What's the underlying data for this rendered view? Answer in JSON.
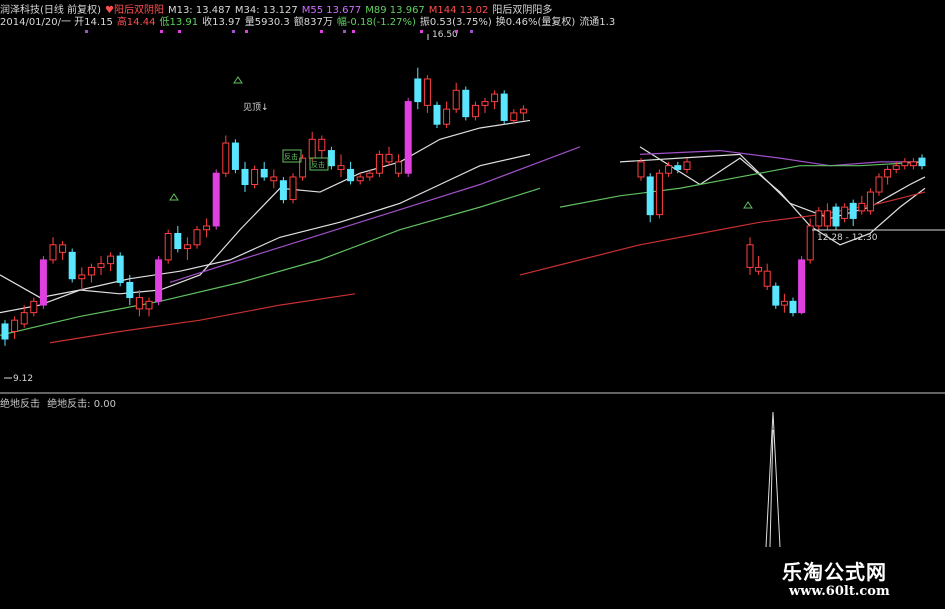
{
  "header": {
    "line1": [
      {
        "text": "润泽科技(日线 前复权)",
        "color": "#d8d8d8"
      },
      {
        "text": "♥阳后双阴阳",
        "color": "#ff5050"
      },
      {
        "text": "M13: 13.487",
        "color": "#d8d8d8"
      },
      {
        "text": "M34: 13.127",
        "color": "#d8d8d8"
      },
      {
        "text": "M55 13.677",
        "color": "#d070ff"
      },
      {
        "text": "M89 13.967",
        "color": "#60d060"
      },
      {
        "text": "M144 13.02",
        "color": "#ff5050"
      },
      {
        "text": "阳后双阴阳多",
        "color": "#d8d8d8"
      }
    ],
    "line2": [
      {
        "text": "2014/01/20/一 开14.15",
        "color": "#d8d8d8"
      },
      {
        "text": "高14.44",
        "color": "#ff5050"
      },
      {
        "text": "低13.91",
        "color": "#60d060"
      },
      {
        "text": "收13.97",
        "color": "#d8d8d8"
      },
      {
        "text": "量5930.3",
        "color": "#d8d8d8"
      },
      {
        "text": "额837万",
        "color": "#d8d8d8"
      },
      {
        "text": "幅-0.18(-1.27%)",
        "color": "#60d060"
      },
      {
        "text": "振0.53(3.75%)",
        "color": "#d8d8d8"
      },
      {
        "text": "换0.46%(量复权)",
        "color": "#d8d8d8"
      },
      {
        "text": "流通1.3",
        "color": "#d8d8d8"
      }
    ]
  },
  "indicator": {
    "name": "绝地反击",
    "label": "绝地反击: 0.00"
  },
  "annotations": {
    "high_label": "16.50",
    "low_label": "9.12",
    "jianding": "见顶↓",
    "range_label": "12.28 - 12.30",
    "fan": "反击"
  },
  "watermark": {
    "cn": "乐淘公式网",
    "url": "www.60lt.com"
  },
  "colors": {
    "up": "#ff4040",
    "down": "#5ae6ff",
    "magenta": "#e040e0",
    "ma_white": "#e0e0e0",
    "ma_purple": "#a050c8",
    "ma_green": "#60c060",
    "ma_red": "#c83030"
  },
  "chart_data": {
    "type": "candlestick",
    "y_axis_price_range": [
      9.12,
      16.5
    ],
    "candles_left": [
      {
        "o": 9.3,
        "h": 9.8,
        "l": 9.12,
        "c": 9.7,
        "k": "down"
      },
      {
        "o": 9.5,
        "h": 9.9,
        "l": 9.3,
        "c": 9.8,
        "k": "up"
      },
      {
        "o": 9.7,
        "h": 10.2,
        "l": 9.6,
        "c": 10.0,
        "k": "up"
      },
      {
        "o": 10.0,
        "h": 10.4,
        "l": 9.9,
        "c": 10.3,
        "k": "up"
      },
      {
        "o": 10.2,
        "h": 11.5,
        "l": 10.1,
        "c": 11.4,
        "k": "m"
      },
      {
        "o": 11.4,
        "h": 12.0,
        "l": 11.3,
        "c": 11.8,
        "k": "up"
      },
      {
        "o": 11.8,
        "h": 11.9,
        "l": 11.4,
        "c": 11.6,
        "k": "up"
      },
      {
        "o": 11.6,
        "h": 11.7,
        "l": 10.8,
        "c": 10.9,
        "k": "down"
      },
      {
        "o": 10.9,
        "h": 11.2,
        "l": 10.6,
        "c": 11.0,
        "k": "up"
      },
      {
        "o": 11.0,
        "h": 11.3,
        "l": 10.8,
        "c": 11.2,
        "k": "up"
      },
      {
        "o": 11.2,
        "h": 11.5,
        "l": 11.0,
        "c": 11.3,
        "k": "up"
      },
      {
        "o": 11.3,
        "h": 11.6,
        "l": 11.1,
        "c": 11.5,
        "k": "up"
      },
      {
        "o": 11.5,
        "h": 11.6,
        "l": 10.7,
        "c": 10.8,
        "k": "down"
      },
      {
        "o": 10.8,
        "h": 11.0,
        "l": 10.2,
        "c": 10.4,
        "k": "down"
      },
      {
        "o": 10.4,
        "h": 10.6,
        "l": 9.9,
        "c": 10.1,
        "k": "up"
      },
      {
        "o": 10.1,
        "h": 10.4,
        "l": 9.9,
        "c": 10.3,
        "k": "up"
      },
      {
        "o": 10.3,
        "h": 11.5,
        "l": 10.2,
        "c": 11.4,
        "k": "m"
      },
      {
        "o": 11.4,
        "h": 12.2,
        "l": 11.3,
        "c": 12.1,
        "k": "up"
      },
      {
        "o": 12.1,
        "h": 12.3,
        "l": 11.6,
        "c": 11.7,
        "k": "down"
      },
      {
        "o": 11.7,
        "h": 12.0,
        "l": 11.4,
        "c": 11.8,
        "k": "up"
      },
      {
        "o": 11.8,
        "h": 12.3,
        "l": 11.7,
        "c": 12.2,
        "k": "up"
      },
      {
        "o": 12.2,
        "h": 12.5,
        "l": 12.0,
        "c": 12.3,
        "k": "up"
      },
      {
        "o": 12.3,
        "h": 13.8,
        "l": 12.2,
        "c": 13.7,
        "k": "m"
      },
      {
        "o": 13.7,
        "h": 14.7,
        "l": 13.6,
        "c": 14.5,
        "k": "up"
      },
      {
        "o": 14.5,
        "h": 14.6,
        "l": 13.7,
        "c": 13.8,
        "k": "down"
      },
      {
        "o": 13.8,
        "h": 14.0,
        "l": 13.2,
        "c": 13.4,
        "k": "down"
      },
      {
        "o": 13.4,
        "h": 13.9,
        "l": 13.3,
        "c": 13.8,
        "k": "up"
      },
      {
        "o": 13.8,
        "h": 14.0,
        "l": 13.5,
        "c": 13.6,
        "k": "down"
      },
      {
        "o": 13.6,
        "h": 13.8,
        "l": 13.3,
        "c": 13.5,
        "k": "up"
      },
      {
        "o": 13.5,
        "h": 13.6,
        "l": 12.9,
        "c": 13.0,
        "k": "down"
      },
      {
        "o": 13.0,
        "h": 13.7,
        "l": 12.9,
        "c": 13.6,
        "k": "up"
      },
      {
        "o": 13.6,
        "h": 14.2,
        "l": 13.5,
        "c": 14.1,
        "k": "up"
      },
      {
        "o": 14.1,
        "h": 14.8,
        "l": 14.0,
        "c": 14.6,
        "k": "up"
      },
      {
        "o": 14.6,
        "h": 14.7,
        "l": 14.1,
        "c": 14.3,
        "k": "up"
      },
      {
        "o": 14.3,
        "h": 14.4,
        "l": 13.8,
        "c": 13.9,
        "k": "down"
      },
      {
        "o": 13.9,
        "h": 14.2,
        "l": 13.6,
        "c": 13.8,
        "k": "up"
      },
      {
        "o": 13.8,
        "h": 14.0,
        "l": 13.4,
        "c": 13.5,
        "k": "down"
      },
      {
        "o": 13.5,
        "h": 13.7,
        "l": 13.4,
        "c": 13.6,
        "k": "up"
      },
      {
        "o": 13.6,
        "h": 13.8,
        "l": 13.5,
        "c": 13.7,
        "k": "up"
      },
      {
        "o": 13.7,
        "h": 14.3,
        "l": 13.6,
        "c": 14.2,
        "k": "up"
      },
      {
        "o": 14.2,
        "h": 14.4,
        "l": 13.9,
        "c": 14.0,
        "k": "up"
      },
      {
        "o": 14.0,
        "h": 14.2,
        "l": 13.6,
        "c": 13.7,
        "k": "up"
      },
      {
        "o": 13.7,
        "h": 15.7,
        "l": 13.6,
        "c": 15.6,
        "k": "m"
      },
      {
        "o": 15.6,
        "h": 16.5,
        "l": 15.4,
        "c": 16.2,
        "k": "down"
      },
      {
        "o": 16.2,
        "h": 16.3,
        "l": 15.3,
        "c": 15.5,
        "k": "up"
      },
      {
        "o": 15.5,
        "h": 15.6,
        "l": 14.9,
        "c": 15.0,
        "k": "down"
      },
      {
        "o": 15.0,
        "h": 15.6,
        "l": 14.9,
        "c": 15.4,
        "k": "up"
      },
      {
        "o": 15.4,
        "h": 16.1,
        "l": 15.3,
        "c": 15.9,
        "k": "up"
      },
      {
        "o": 15.9,
        "h": 16.0,
        "l": 15.1,
        "c": 15.2,
        "k": "down"
      },
      {
        "o": 15.2,
        "h": 15.6,
        "l": 15.1,
        "c": 15.5,
        "k": "up"
      },
      {
        "o": 15.5,
        "h": 15.7,
        "l": 15.3,
        "c": 15.6,
        "k": "up"
      },
      {
        "o": 15.6,
        "h": 15.9,
        "l": 15.4,
        "c": 15.8,
        "k": "up"
      },
      {
        "o": 15.8,
        "h": 15.9,
        "l": 15.0,
        "c": 15.1,
        "k": "down"
      },
      {
        "o": 15.1,
        "h": 15.4,
        "l": 15.0,
        "c": 15.3,
        "k": "up"
      },
      {
        "o": 15.3,
        "h": 15.5,
        "l": 15.1,
        "c": 15.4,
        "k": "up"
      }
    ],
    "candles_right": [
      {
        "o": 14.0,
        "h": 14.1,
        "l": 13.5,
        "c": 13.6,
        "k": "up"
      },
      {
        "o": 13.6,
        "h": 13.7,
        "l": 12.4,
        "c": 12.6,
        "k": "down"
      },
      {
        "o": 12.6,
        "h": 13.8,
        "l": 12.5,
        "c": 13.7,
        "k": "up"
      },
      {
        "o": 13.7,
        "h": 14.0,
        "l": 13.6,
        "c": 13.9,
        "k": "up"
      },
      {
        "o": 13.9,
        "h": 14.0,
        "l": 13.7,
        "c": 13.8,
        "k": "down"
      },
      {
        "o": 13.8,
        "h": 14.1,
        "l": 13.7,
        "c": 14.0,
        "k": "up"
      }
    ],
    "candles_right2": [
      {
        "o": 11.8,
        "h": 12.0,
        "l": 11.0,
        "c": 11.2,
        "k": "up"
      },
      {
        "o": 11.2,
        "h": 11.5,
        "l": 11.0,
        "c": 11.1,
        "k": "up"
      },
      {
        "o": 11.1,
        "h": 11.3,
        "l": 10.6,
        "c": 10.7,
        "k": "up"
      },
      {
        "o": 10.7,
        "h": 10.8,
        "l": 10.1,
        "c": 10.2,
        "k": "down"
      },
      {
        "o": 10.2,
        "h": 10.5,
        "l": 10.0,
        "c": 10.3,
        "k": "up"
      },
      {
        "o": 10.3,
        "h": 10.4,
        "l": 9.9,
        "c": 10.0,
        "k": "down"
      },
      {
        "o": 10.0,
        "h": 11.5,
        "l": 9.95,
        "c": 11.4,
        "k": "m"
      },
      {
        "o": 11.4,
        "h": 12.5,
        "l": 11.3,
        "c": 12.3,
        "k": "up"
      },
      {
        "o": 12.3,
        "h": 12.8,
        "l": 12.2,
        "c": 12.7,
        "k": "up"
      },
      {
        "o": 12.7,
        "h": 12.9,
        "l": 12.2,
        "c": 12.3,
        "k": "up"
      },
      {
        "o": 12.3,
        "h": 12.9,
        "l": 12.2,
        "c": 12.8,
        "k": "down"
      },
      {
        "o": 12.8,
        "h": 12.9,
        "l": 12.4,
        "c": 12.5,
        "k": "up"
      },
      {
        "o": 12.5,
        "h": 13.0,
        "l": 12.3,
        "c": 12.9,
        "k": "down"
      },
      {
        "o": 12.9,
        "h": 13.1,
        "l": 12.6,
        "c": 12.7,
        "k": "up"
      },
      {
        "o": 12.7,
        "h": 13.3,
        "l": 12.6,
        "c": 13.2,
        "k": "up"
      },
      {
        "o": 13.2,
        "h": 13.7,
        "l": 13.1,
        "c": 13.6,
        "k": "up"
      },
      {
        "o": 13.6,
        "h": 13.9,
        "l": 13.4,
        "c": 13.8,
        "k": "up"
      },
      {
        "o": 13.8,
        "h": 14.0,
        "l": 13.7,
        "c": 13.9,
        "k": "up"
      },
      {
        "o": 13.9,
        "h": 14.1,
        "l": 13.8,
        "c": 14.0,
        "k": "up"
      },
      {
        "o": 14.0,
        "h": 14.1,
        "l": 13.8,
        "c": 13.9,
        "k": "up"
      },
      {
        "o": 13.9,
        "h": 14.2,
        "l": 13.8,
        "c": 14.1,
        "k": "down"
      }
    ],
    "indicator_value": 0.0
  }
}
